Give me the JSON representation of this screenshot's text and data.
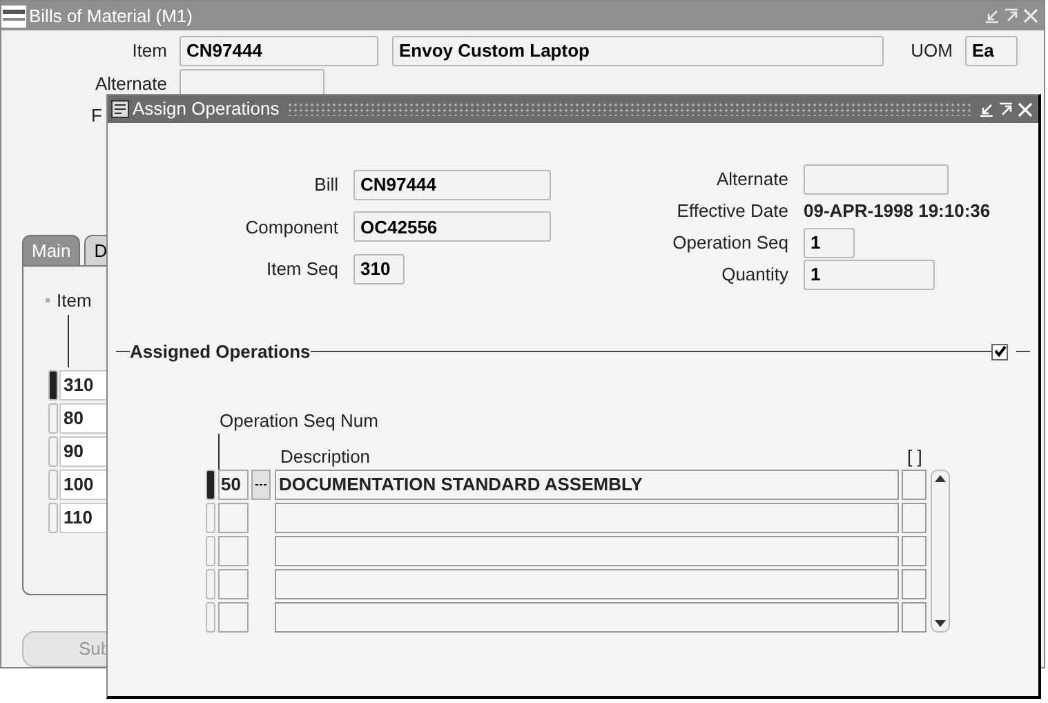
{
  "main_window": {
    "title": "Bills of Material (M1)",
    "item": {
      "label": "Item",
      "value": "CN97444",
      "description": "Envoy Custom Laptop"
    },
    "uom": {
      "label": "UOM",
      "value": "Ea"
    },
    "alternate": {
      "label": "Alternate"
    },
    "cut_label": "F",
    "tabs": [
      {
        "label": "Main",
        "selected": true
      },
      {
        "label": "D",
        "selected": false
      }
    ],
    "column_header": "Item",
    "rows": [
      {
        "value": "310",
        "selected": true
      },
      {
        "value": "80",
        "selected": false
      },
      {
        "value": "90",
        "selected": false
      },
      {
        "value": "100",
        "selected": false
      },
      {
        "value": "110",
        "selected": false
      }
    ],
    "button": "Sub"
  },
  "dialog": {
    "title": "Assign Operations",
    "fields_left": [
      {
        "label": "Bill",
        "value": "CN97444",
        "kind": "field"
      },
      {
        "label": "Component",
        "value": "OC42556",
        "kind": "field"
      },
      {
        "label": "Item Seq",
        "value": "310",
        "kind": "short"
      }
    ],
    "fields_right": [
      {
        "label": "Alternate",
        "kind": "field"
      },
      {
        "label": "Effective Date",
        "value": "09-APR-1998 19:10:36",
        "kind": "text"
      },
      {
        "label": "Operation Seq",
        "value": "1",
        "kind": "short"
      },
      {
        "label": "Quantity",
        "value": "1",
        "kind": "field"
      }
    ],
    "section": {
      "title": "Assigned Operations",
      "checked": true
    },
    "table": {
      "columns": [
        "Operation Seq Num",
        "Description",
        "[ ]"
      ],
      "rows": [
        {
          "selected": true,
          "seq": "50",
          "description": "DOCUMENTATION STANDARD ASSEMBLY"
        },
        {
          "selected": false
        },
        {
          "selected": false
        },
        {
          "selected": false
        },
        {
          "selected": false
        }
      ]
    }
  }
}
